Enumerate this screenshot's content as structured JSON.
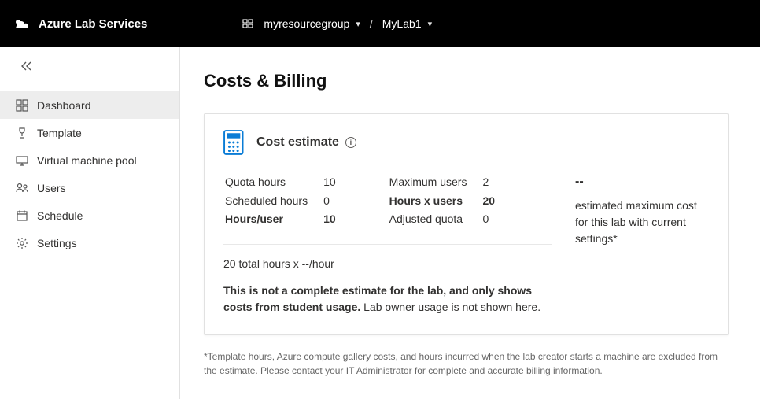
{
  "header": {
    "product": "Azure Lab Services",
    "resource_group": "myresourcegroup",
    "lab_name": "MyLab1"
  },
  "sidebar": {
    "items": [
      {
        "label": "Dashboard"
      },
      {
        "label": "Template"
      },
      {
        "label": "Virtual machine pool"
      },
      {
        "label": "Users"
      },
      {
        "label": "Schedule"
      },
      {
        "label": "Settings"
      }
    ]
  },
  "page": {
    "title": "Costs & Billing"
  },
  "cost_card": {
    "title": "Cost estimate",
    "metrics_left": {
      "quota_hours_label": "Quota hours",
      "quota_hours_value": "10",
      "scheduled_hours_label": "Scheduled hours",
      "scheduled_hours_value": "0",
      "hours_per_user_label": "Hours/user",
      "hours_per_user_value": "10"
    },
    "metrics_right": {
      "max_users_label": "Maximum users",
      "max_users_value": "2",
      "hours_x_users_label": "Hours x users",
      "hours_x_users_value": "20",
      "adjusted_quota_label": "Adjusted quota",
      "adjusted_quota_value": "0"
    },
    "calc_line": "20 total hours x --/hour",
    "disclaimer_strong": "This is not a complete estimate for the lab, and only shows costs from student usage.",
    "disclaimer_rest": " Lab owner usage is not shown here.",
    "summary_value": "--",
    "summary_text": "estimated maximum cost for this lab with current settings*"
  },
  "footnote": "*Template hours, Azure compute gallery costs, and hours incurred when the lab creator starts a machine are excluded from the estimate. Please contact your IT Administrator for complete and accurate billing information."
}
